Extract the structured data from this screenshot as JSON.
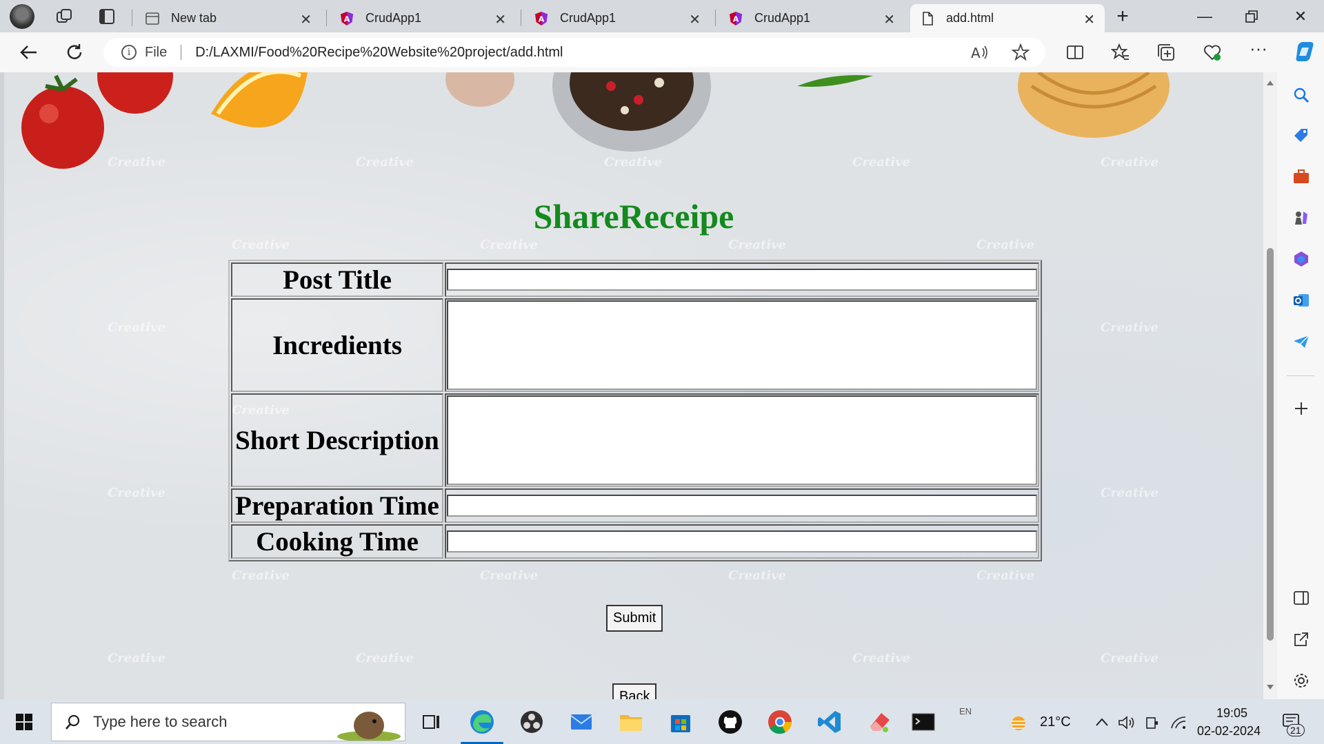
{
  "browser": {
    "tabs": [
      {
        "label": "New tab",
        "active": false,
        "icon": "new-tab-page-icon"
      },
      {
        "label": "CrudApp1",
        "active": false,
        "icon": "angular-icon"
      },
      {
        "label": "CrudApp1",
        "active": false,
        "icon": "angular-icon"
      },
      {
        "label": "CrudApp1",
        "active": false,
        "icon": "angular-icon"
      },
      {
        "label": "add.html",
        "active": true,
        "icon": "file-icon"
      }
    ],
    "address": {
      "scheme_label": "File",
      "url": "D:/LAXMI/Food%20Recipe%20Website%20project/add.html"
    }
  },
  "page": {
    "title": "ShareReceipe",
    "watermark": "Creative",
    "form": {
      "fields": [
        {
          "label": "Post Title",
          "type": "input",
          "value": ""
        },
        {
          "label": "Incredients",
          "type": "textarea",
          "value": ""
        },
        {
          "label": "Short Description",
          "type": "textarea",
          "value": ""
        },
        {
          "label": "Preparation Time",
          "type": "input",
          "value": ""
        },
        {
          "label": "Cooking Time",
          "type": "input",
          "value": ""
        }
      ],
      "submit_label": "Submit",
      "back_label": "Back"
    }
  },
  "taskbar": {
    "search_placeholder": "Type here to search",
    "weather": "21°C",
    "language": "EN",
    "time": "19:05",
    "date": "02-02-2024",
    "notification_count": "21"
  },
  "colors": {
    "title_green": "#138a1e",
    "accent": "#0067c0"
  }
}
